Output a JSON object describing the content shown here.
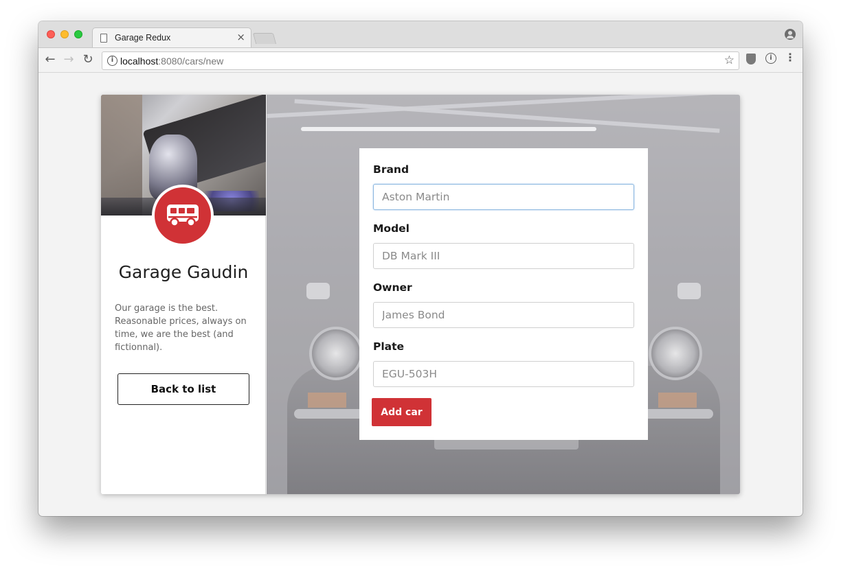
{
  "browser": {
    "tab_title": "Garage Redux",
    "tab_close": "×",
    "url_host": "localhost",
    "url_path": ":8080/cars/new",
    "nav": {
      "back": "←",
      "forward": "→",
      "reload": "↻"
    },
    "info_glyph": "i",
    "star_glyph": "☆",
    "menu_glyph": "⋮",
    "icons": [
      "file-icon",
      "close-icon",
      "profile-icon",
      "info-icon",
      "star-icon",
      "ublock-icon",
      "menu-icon"
    ]
  },
  "sidebar": {
    "garage_name": "Garage Gaudin",
    "description": "Our garage is the best. Reasonable prices, always on time, we are the best (and fictionnal).",
    "back_button": "Back to list",
    "logo_icon": "bus-icon",
    "logo_color": "#d03236"
  },
  "form": {
    "fields": [
      {
        "label": "Brand",
        "placeholder": "Aston Martin",
        "value": ""
      },
      {
        "label": "Model",
        "placeholder": "DB Mark III",
        "value": ""
      },
      {
        "label": "Owner",
        "placeholder": "James Bond",
        "value": ""
      },
      {
        "label": "Plate",
        "placeholder": "EGU-503H",
        "value": ""
      }
    ],
    "submit_label": "Add car",
    "accent_color": "#d03236"
  }
}
